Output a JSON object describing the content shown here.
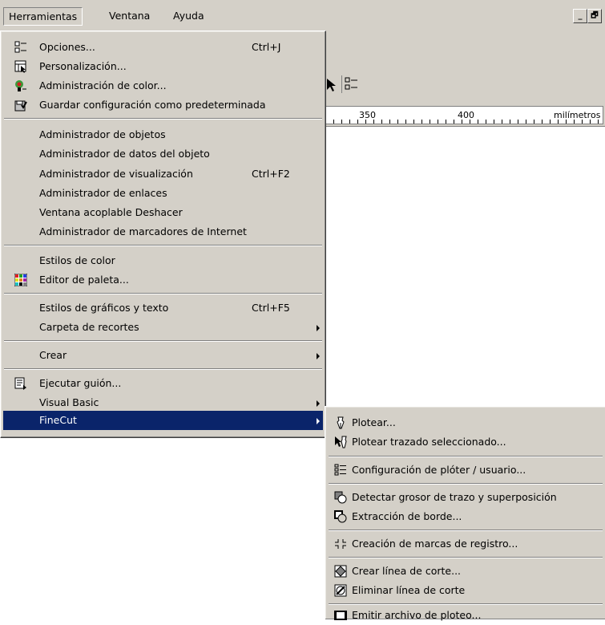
{
  "menubar": {
    "items": [
      "Herramientas",
      "Ventana",
      "Ayuda"
    ],
    "window_buttons": [
      "_",
      "🗗"
    ]
  },
  "ruler": {
    "labels": [
      "350",
      "400",
      "milímetros"
    ]
  },
  "main_menu": {
    "items": [
      {
        "label": "Opciones...",
        "shortcut": "Ctrl+J",
        "icon": "options-icon"
      },
      {
        "label": "Personalización...",
        "icon": "customize-icon"
      },
      {
        "label": "Administración de color...",
        "icon": "color-management-icon"
      },
      {
        "label": "Guardar configuración como predeterminada",
        "icon": "save-settings-icon"
      },
      {
        "label": "Administrador de objetos"
      },
      {
        "label": "Administrador de datos del objeto"
      },
      {
        "label": "Administrador de visualización",
        "shortcut": "Ctrl+F2"
      },
      {
        "label": "Administrador de enlaces"
      },
      {
        "label": "Ventana acoplable Deshacer"
      },
      {
        "label": "Administrador de marcadores de Internet"
      },
      {
        "label": "Estilos de color"
      },
      {
        "label": "Editor de paleta...",
        "icon": "palette-editor-icon"
      },
      {
        "label": "Estilos de gráficos y texto",
        "shortcut": "Ctrl+F5"
      },
      {
        "label": "Carpeta de recortes",
        "submenu": true
      },
      {
        "label": "Crear",
        "submenu": true
      },
      {
        "label": "Ejecutar guión...",
        "icon": "run-script-icon"
      },
      {
        "label": "Visual Basic",
        "submenu": true
      },
      {
        "label": "FineCut",
        "submenu": true,
        "highlighted": true
      }
    ]
  },
  "sub_menu": {
    "items": [
      {
        "label": "Plotear...",
        "icon": "plot-pen-icon"
      },
      {
        "label": "Plotear trazado seleccionado...",
        "icon": "plot-selected-icon"
      },
      {
        "label": "Configuración de plóter / usuario...",
        "icon": "plotter-settings-icon"
      },
      {
        "label": "Detectar grosor de trazo y superposición",
        "icon": "detect-stroke-icon"
      },
      {
        "label": "Extracción de borde...",
        "icon": "edge-extraction-icon"
      },
      {
        "label": "Creación de marcas de registro...",
        "icon": "register-marks-icon"
      },
      {
        "label": "Crear línea de corte...",
        "icon": "create-cutline-icon"
      },
      {
        "label": "Eliminar línea de corte",
        "icon": "delete-cutline-icon"
      },
      {
        "label": "Emitir archivo de ploteo...",
        "icon": "output-plot-file-icon"
      }
    ]
  }
}
